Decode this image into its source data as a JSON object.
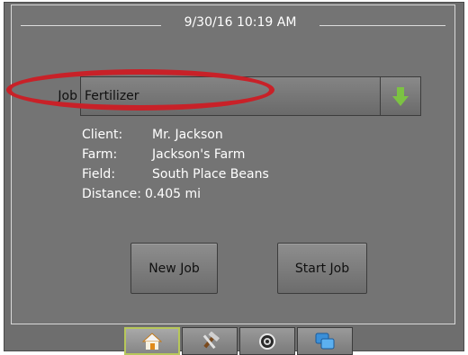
{
  "header": {
    "datetime": "9/30/16 10:19 AM"
  },
  "job": {
    "label": "Job",
    "selected": "Fertilizer",
    "dropdown_icon": "arrow-down-icon"
  },
  "details": [
    {
      "label": "Client:",
      "value": "Mr. Jackson"
    },
    {
      "label": "Farm:",
      "value": "Jackson's Farm"
    },
    {
      "label": "Field:",
      "value": "South Place Beans"
    },
    {
      "label": "Distance:",
      "value": "0.405 mi"
    }
  ],
  "buttons": {
    "new_job": "New Job",
    "start_job": "Start Job"
  },
  "tabs": [
    {
      "icon": "home-icon",
      "active": true
    },
    {
      "icon": "tools-icon",
      "active": false
    },
    {
      "icon": "gauge-icon",
      "active": false
    },
    {
      "icon": "windows-icon",
      "active": false
    }
  ],
  "colors": {
    "highlight": "#c82128",
    "arrow": "#7cc243",
    "tab_active_border": "#b7c75a"
  }
}
